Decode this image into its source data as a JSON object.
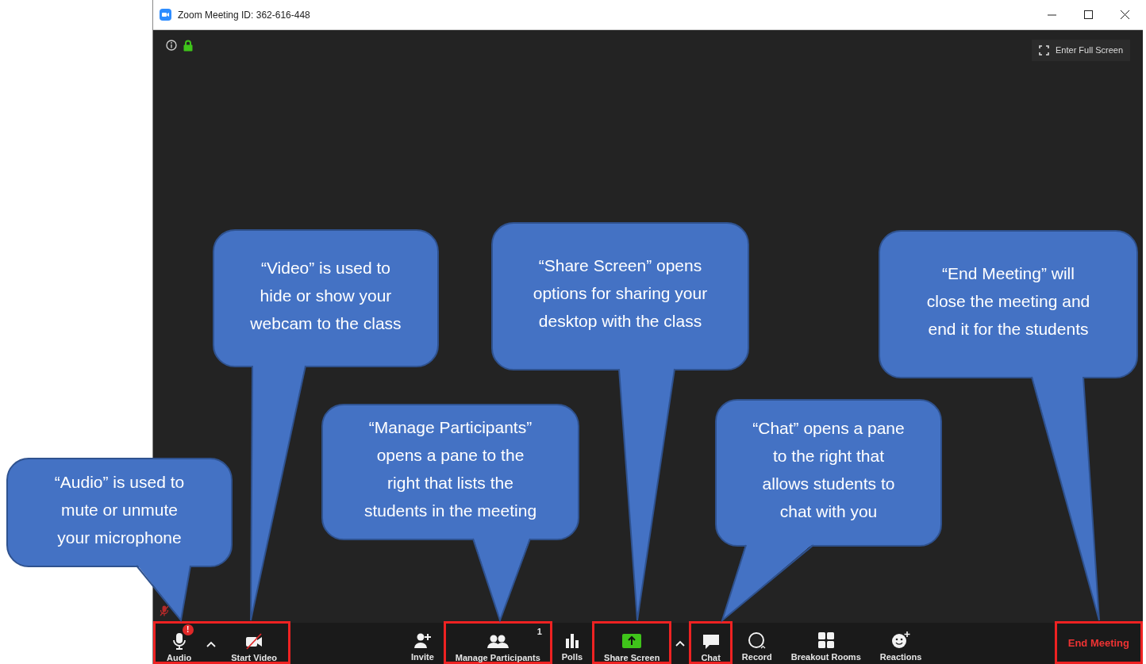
{
  "window": {
    "title": "Zoom Meeting ID: 362-616-448"
  },
  "full_screen_button": {
    "label": "Enter Full Screen"
  },
  "toolbar": {
    "left": [
      {
        "highlighted": true,
        "items": [
          {
            "kind": "audio",
            "label": "Audio",
            "badge": "!"
          },
          {
            "kind": "caret"
          },
          {
            "kind": "video",
            "label": "Start Video",
            "off": true
          }
        ]
      }
    ],
    "center": [
      {
        "highlighted": false,
        "items": [
          {
            "kind": "invite",
            "label": "Invite"
          }
        ]
      },
      {
        "highlighted": true,
        "items": [
          {
            "kind": "participants",
            "label": "Manage Participants",
            "count": "1"
          }
        ]
      },
      {
        "highlighted": false,
        "items": [
          {
            "kind": "polls",
            "label": "Polls"
          }
        ]
      },
      {
        "highlighted": true,
        "items": [
          {
            "kind": "share",
            "label": "Share Screen"
          }
        ]
      },
      {
        "highlighted": false,
        "items": [
          {
            "kind": "caret"
          }
        ]
      },
      {
        "highlighted": true,
        "items": [
          {
            "kind": "chat",
            "label": "Chat"
          }
        ]
      },
      {
        "highlighted": false,
        "items": [
          {
            "kind": "record",
            "label": "Record"
          },
          {
            "kind": "breakout",
            "label": "Breakout Rooms"
          },
          {
            "kind": "reactions",
            "label": "Reactions"
          }
        ]
      }
    ],
    "right": [
      {
        "highlighted": true,
        "items": [
          {
            "kind": "end",
            "label": "End Meeting"
          }
        ]
      }
    ]
  },
  "callouts": [
    {
      "text": "“Audio” is used to\nmute or unmute\nyour microphone"
    },
    {
      "text": "“Video” is used to\nhide or show your\nwebcam to the class"
    },
    {
      "text": "“Manage Participants”\nopens a pane to the\nright that lists the\nstudents in the meeting"
    },
    {
      "text": "“Share Screen” opens\noptions for sharing your\ndesktop with the class"
    },
    {
      "text": "“Chat” opens a pane\nto the right that\nallows students to\nchat with you"
    },
    {
      "text": "“End Meeting” will\nclose the meeting and\nend it for the students"
    }
  ]
}
